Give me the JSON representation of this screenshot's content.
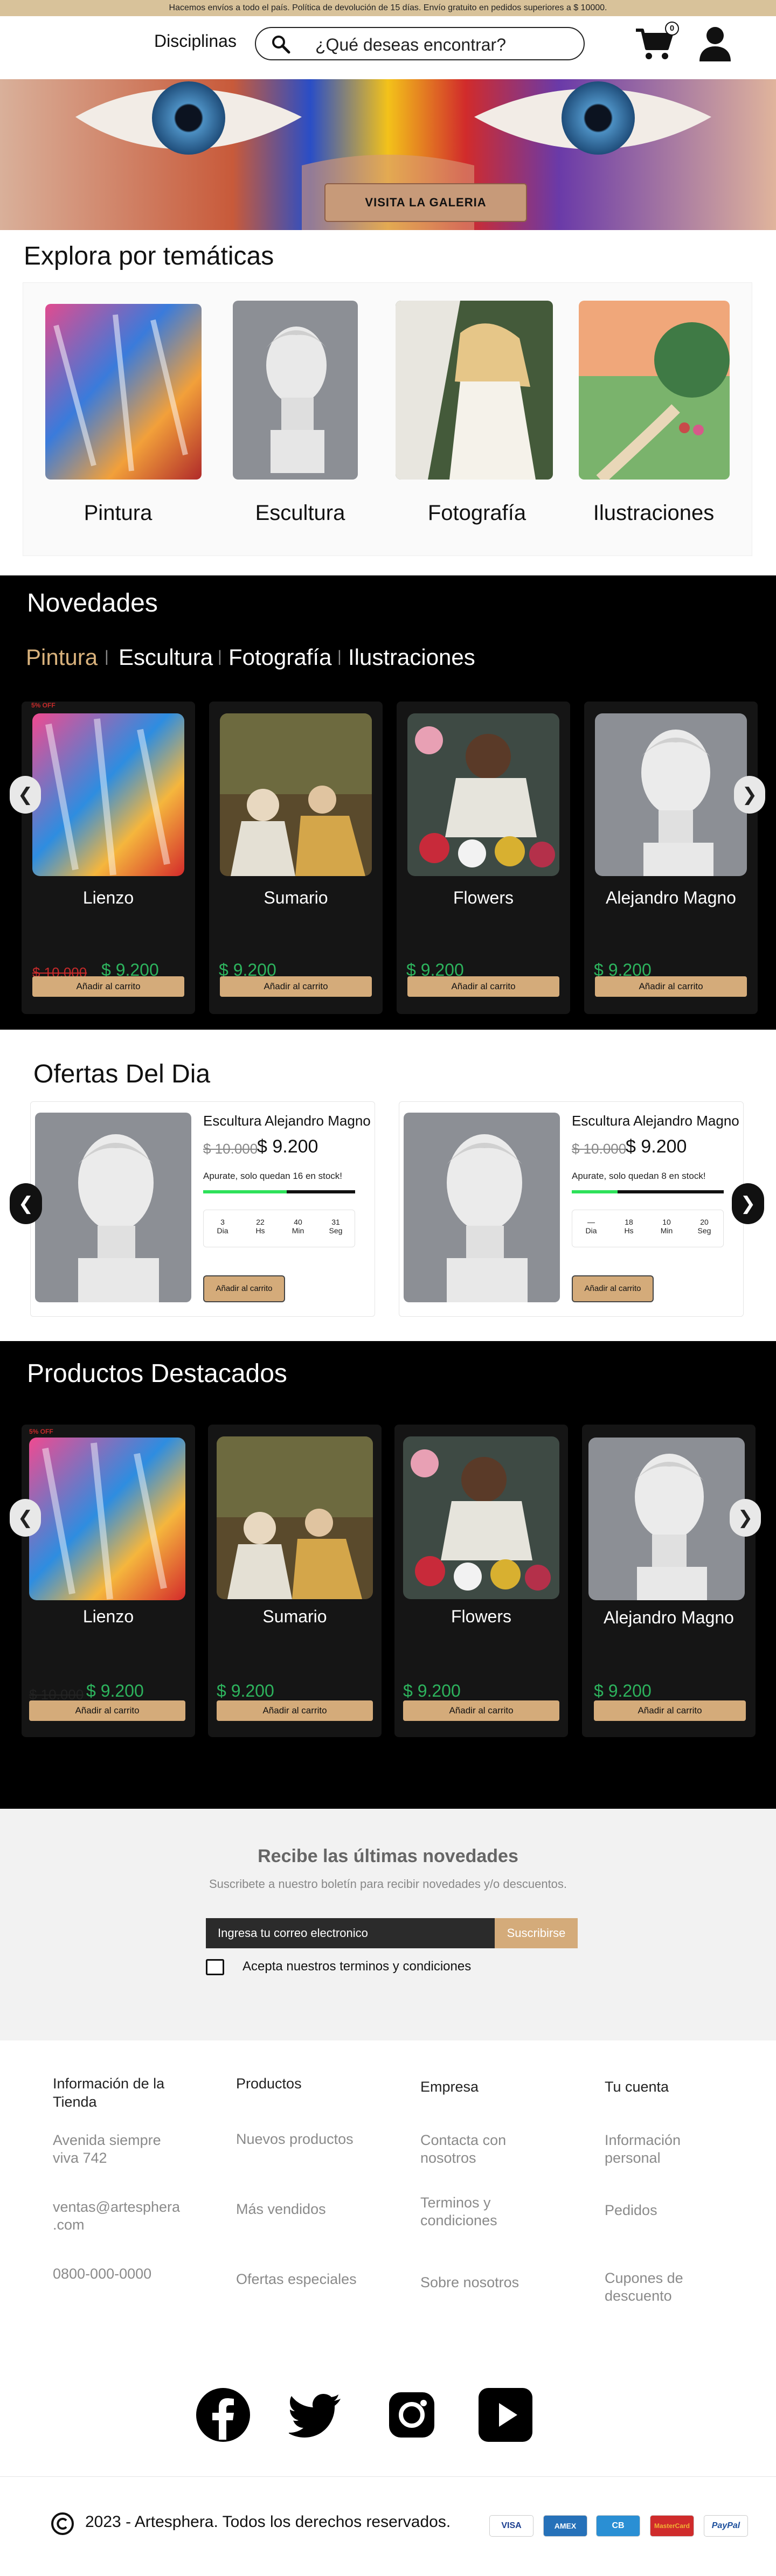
{
  "topbar": {
    "notice": "Hacemos envíos a todo el país. Política de devolución de 15 días. Envío gratuito en pedidos superiores a $ 10000."
  },
  "header": {
    "nav_label": "Disciplinas",
    "search_placeholder": "¿Qué deseas encontrar?",
    "cart_count": "0",
    "icons": [
      "search-icon",
      "cart-icon",
      "user-icon"
    ]
  },
  "hero": {
    "button_label": "VISITA LA GALERIA"
  },
  "themes": {
    "title": "Explora por temáticas",
    "items": [
      {
        "label": "Pintura"
      },
      {
        "label": "Escultura"
      },
      {
        "label": "Fotografía"
      },
      {
        "label": "Ilustraciones"
      }
    ]
  },
  "novedades": {
    "title": "Novedades",
    "tabs": [
      "Pintura",
      "Escultura",
      "Fotografía",
      "Ilustraciones"
    ],
    "products": [
      {
        "title": "Lienzo",
        "badge": "5% OFF",
        "old_price": "$ 10.000",
        "price": "$ 9.200",
        "button": "Añadir al carrito"
      },
      {
        "title": "Sumario",
        "price": "$ 9.200",
        "button": "Añadir al carrito"
      },
      {
        "title": "Flowers",
        "price": "$ 9.200",
        "button": "Añadir al carrito"
      },
      {
        "title": "Alejandro Magno",
        "price": "$ 9.200",
        "button": "Añadir al carrito"
      }
    ]
  },
  "ofertas": {
    "title": "Ofertas Del Dia",
    "items": [
      {
        "title": "Escultura Alejandro Magno",
        "old_price": "$ 10.000",
        "price": "$ 9.200",
        "stock": "Apurate, solo quedan 16 en stock!",
        "stock_fill": 0.55,
        "timer": [
          {
            "v": "3",
            "u": "Dia"
          },
          {
            "v": "22",
            "u": "Hs"
          },
          {
            "v": "40",
            "u": "Min"
          },
          {
            "v": "31",
            "u": "Seg"
          }
        ],
        "button": "Añadir al carrito"
      },
      {
        "title": "Escultura Alejandro Magno",
        "old_price": "$ 10.000",
        "price": "$ 9.200",
        "stock": "Apurate, solo quedan 8 en stock!",
        "stock_fill": 0.3,
        "timer": [
          {
            "v": "—",
            "u": "Dia"
          },
          {
            "v": "18",
            "u": "Hs"
          },
          {
            "v": "10",
            "u": "Min"
          },
          {
            "v": "20",
            "u": "Seg"
          }
        ],
        "button": "Añadir al carrito"
      }
    ]
  },
  "destacados": {
    "title": "Productos Destacados",
    "products": [
      {
        "title": "Lienzo",
        "badge": "5% OFF",
        "old_price": "$ 10.000",
        "price": "$ 9.200",
        "button": "Añadir al carrito"
      },
      {
        "title": "Sumario",
        "price": "$ 9.200",
        "button": "Añadir al carrito"
      },
      {
        "title": "Flowers",
        "price": "$ 9.200",
        "button": "Añadir al carrito"
      },
      {
        "title": "Alejandro Magno",
        "price": "$ 9.200",
        "button": "Añadir al carrito"
      }
    ]
  },
  "newsletter": {
    "title": "Recibe las últimas novedades",
    "subtitle": "Suscribete a nuestro boletín para recibir novedades y/o descuentos.",
    "email_placeholder": "Ingresa tu correo electronico",
    "button": "Suscribirse",
    "terms": "Acepta nuestros terminos y condiciones"
  },
  "footer": {
    "columns": [
      {
        "head": "Información de la Tienda",
        "items": [
          "Avenida siempre viva 742",
          "ventas@artesphera .com",
          "0800-000-0000"
        ]
      },
      {
        "head": "Productos",
        "items": [
          "Nuevos productos",
          "Más vendidos",
          "Ofertas especiales"
        ]
      },
      {
        "head": "Empresa",
        "items": [
          "Contacta con nosotros",
          "Terminos y condiciones",
          "Sobre nosotros"
        ]
      },
      {
        "head": "Tu cuenta",
        "items": [
          "Información personal",
          "Pedidos",
          "Cupones de descuento"
        ]
      }
    ],
    "social": [
      "facebook-icon",
      "twitter-icon",
      "instagram-icon",
      "youtube-icon"
    ],
    "copyright": "2023 - Artesphera. Todos los derechos reservados.",
    "payments": [
      "VISA",
      "AMEX",
      "CB",
      "MasterCard",
      "PayPal"
    ]
  }
}
